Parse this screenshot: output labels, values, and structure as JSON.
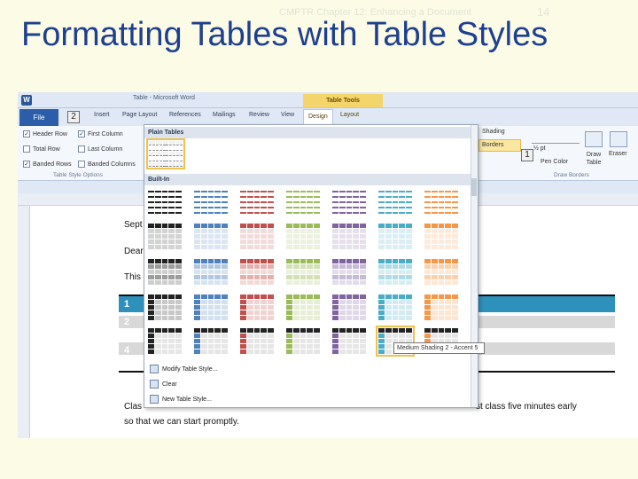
{
  "slide": {
    "header": "CMPTR Chapter 12: Enhancing a Document",
    "number": "14",
    "title": "Formatting Tables with Table Styles"
  },
  "word": {
    "window_title": "Table - Microsoft Word",
    "contextual_tab": "Table Tools",
    "tabs": [
      "File",
      "Insert",
      "Page Layout",
      "References",
      "Mailings",
      "Review",
      "View",
      "Design",
      "Layout"
    ],
    "active_tab": "Design",
    "keytips": {
      "file": "2",
      "borders": "1"
    },
    "options": [
      {
        "label": "Header Row",
        "checked": true
      },
      {
        "label": "First Column",
        "checked": true
      },
      {
        "label": "Total Row",
        "checked": false
      },
      {
        "label": "Last Column",
        "checked": false
      },
      {
        "label": "Banded Rows",
        "checked": true
      },
      {
        "label": "Banded Columns",
        "checked": false
      }
    ],
    "group_labels": {
      "style_options": "Table Style Options",
      "draw_borders": "Draw Borders"
    },
    "ribbon_buttons": {
      "shading": "Shading",
      "borders": "Borders",
      "pen_weight": "½ pt",
      "pen_color": "Pen Color",
      "draw_table": "Draw Table",
      "eraser": "Eraser"
    },
    "document": {
      "line1": "Sept",
      "line2": "Dear",
      "line3": "This",
      "rows": [
        "1",
        "2",
        "3",
        "4",
        "5"
      ],
      "para1": "Clas",
      "para1_end": "st class five minutes early",
      "para2": "so that we can start promptly."
    },
    "gallery": {
      "plain_header": "Plain Tables",
      "builtin_header": "Built-In",
      "menu": [
        "Modify Table Style...",
        "Clear",
        "New Table Style..."
      ],
      "tooltip": "Medium Shading 2 - Accent 5",
      "accent_colors": [
        "#222222",
        "#4f81bd",
        "#c0504d",
        "#9bbb59",
        "#8064a2",
        "#4bacc6",
        "#f79646"
      ]
    }
  }
}
